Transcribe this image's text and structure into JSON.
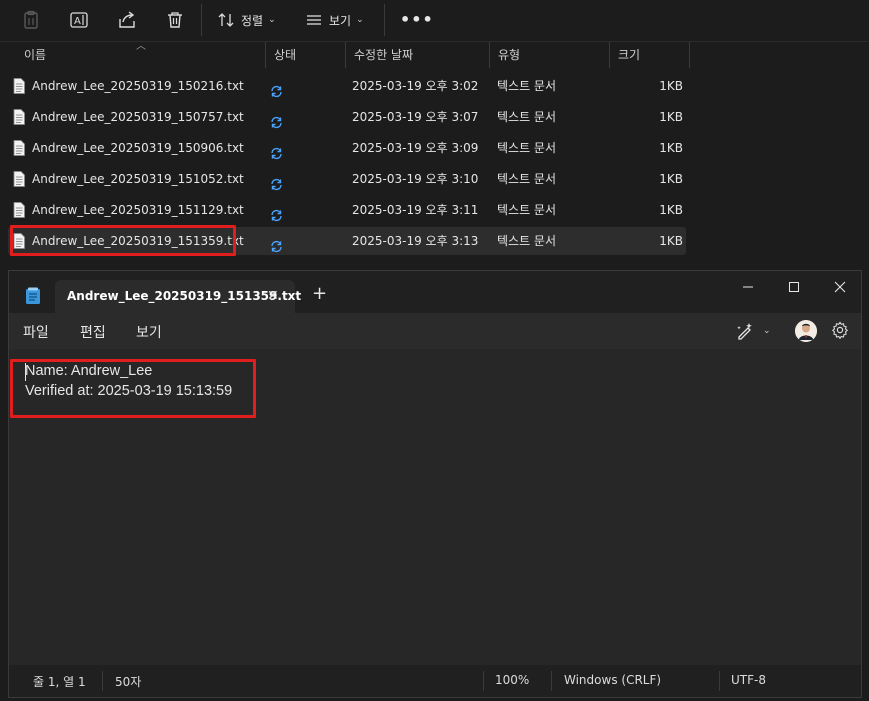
{
  "explorer": {
    "toolbar": {
      "sort_label": "정렬",
      "view_label": "보기",
      "more_label": "•••"
    },
    "columns": {
      "name": "이름",
      "status": "상태",
      "modified": "수정한 날짜",
      "type": "유형",
      "size": "크기"
    },
    "files": [
      {
        "name": "Andrew_Lee_20250319_150216.txt",
        "date": "2025-03-19 오후 3:02",
        "type": "텍스트 문서",
        "size": "1KB"
      },
      {
        "name": "Andrew_Lee_20250319_150757.txt",
        "date": "2025-03-19 오후 3:07",
        "type": "텍스트 문서",
        "size": "1KB"
      },
      {
        "name": "Andrew_Lee_20250319_150906.txt",
        "date": "2025-03-19 오후 3:09",
        "type": "텍스트 문서",
        "size": "1KB"
      },
      {
        "name": "Andrew_Lee_20250319_151052.txt",
        "date": "2025-03-19 오후 3:10",
        "type": "텍스트 문서",
        "size": "1KB"
      },
      {
        "name": "Andrew_Lee_20250319_151129.txt",
        "date": "2025-03-19 오후 3:11",
        "type": "텍스트 문서",
        "size": "1KB"
      },
      {
        "name": "Andrew_Lee_20250319_151359.txt",
        "date": "2025-03-19 오후 3:13",
        "type": "텍스트 문서",
        "size": "1KB"
      }
    ],
    "selected_index": 5
  },
  "notepad": {
    "tab_title": "Andrew_Lee_20250319_151359.txt",
    "tab_close": "✕",
    "new_tab": "+",
    "menu": {
      "file": "파일",
      "edit": "편집",
      "view": "보기"
    },
    "content_lines": [
      "Name: Andrew_Lee",
      "Verified at: 2025-03-19 15:13:59"
    ],
    "status": {
      "position": "줄 1, 열 1",
      "chars": "50자",
      "zoom": "100%",
      "line_ending": "Windows (CRLF)",
      "encoding": "UTF-8"
    }
  },
  "colors": {
    "highlight": "#e01e1e",
    "sync_icon": "#4aa3ff",
    "notepad_icon": "#3a96dd"
  }
}
